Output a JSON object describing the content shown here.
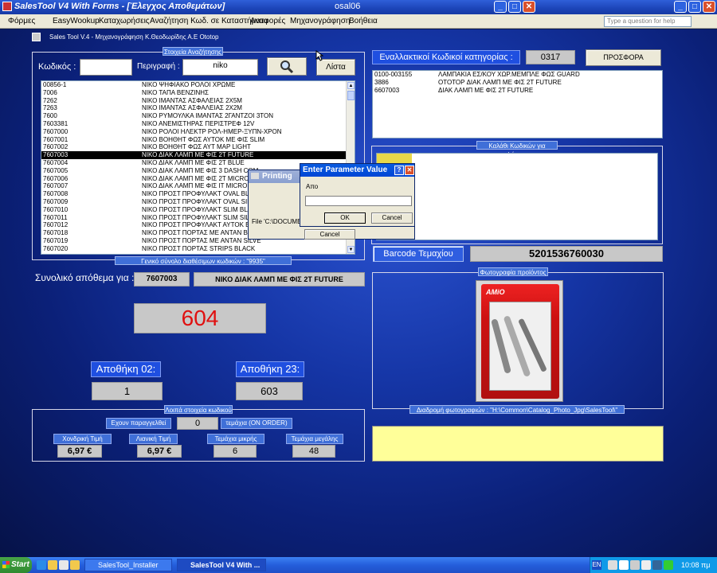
{
  "window": {
    "title": "SalesTool V4 With Forms - [Έλεγχος Αποθεμάτων]",
    "center_title": "osal06",
    "min": "_",
    "max": "□",
    "close": "✕"
  },
  "menu": {
    "items": [
      "Φόρμες",
      "EasyWookup",
      "Καταχωρήσεις",
      "Αναζήτηση Κωδ. σε Καταστήματα",
      "Αναφορές",
      "Μηχανογράφηση",
      "Βοήθεια"
    ],
    "help_placeholder": "Type a question for help"
  },
  "header": {
    "app_caption": "Sales Tool V.4 - Μηχανογράφηση Κ.Θεοδωρίδης Α.Ε  Ototop"
  },
  "search": {
    "caption": "Στοιχεία Αναζήτησης",
    "code_label": "Κωδικός :",
    "code_value": "",
    "desc_label": "Περιγραφή :",
    "desc_value": "niko",
    "list_button": "Λίστα",
    "search_icon": "magnifier-icon"
  },
  "results": {
    "rows": [
      {
        "code": "00856-1",
        "desc": "ΝΙΚΟ ΨΗΦΙΑΚΟ ΡΟΛΟΙ ΧΡΩΜΕ"
      },
      {
        "code": "7006",
        "desc": "ΝΙΚΟ ΤΑΠΑ ΒΕΝΖΙΝΗΣ"
      },
      {
        "code": "7262",
        "desc": "ΝΙΚΟ ΙΜΑΝΤΑΣ ΑΣΦΑΛΕΙΑΣ 2Χ5Μ"
      },
      {
        "code": "7263",
        "desc": "ΝΙΚΟ ΙΜΑΝΤΑΣ ΑΣΦΑΛΕΙΑΣ 2Χ2Μ"
      },
      {
        "code": "7600",
        "desc": "ΝΙΚΟ ΡΥΜΟΥΛΚΑ ΙΜΑΝΤΑΣ 2ΓΑΝΤΖΟΙ 3ΤΟΝ"
      },
      {
        "code": "7603381",
        "desc": "ΝΙΚΟ ΑΝΕΜΙΣΤΗΡΑΣ ΠΕΡΙΣΤΡΕΦ 12V"
      },
      {
        "code": "7607000",
        "desc": "ΝΙΚΟ ΡΟΛΟΙ ΗΛΕΚΤΡ ΡΟΛ-ΗΜΕΡ-ΞΥΠΝ-ΧΡΟΝ"
      },
      {
        "code": "7607001",
        "desc": "ΝΙΚΟ ΒΟΗΘΗΤ ΦΩΣ ΑΥΤΟΚ ΜΕ ΦΙΣ SLIM"
      },
      {
        "code": "7607002",
        "desc": "ΝΙΚΟ ΒΟΗΘΗΤ ΦΩΣ ΑΥΤ ΜΑΡ LIGHT"
      },
      {
        "code": "7607003",
        "desc": "ΝΙΚΟ ΔΙΑΚ ΛΑΜΠ ΜΕ ΦΙΣ 2Τ FUTURE"
      },
      {
        "code": "7607004",
        "desc": "ΝΙΚΟ ΔΙΑΚ ΛΑΜΠ ΜΕ ΦΙΣ 2Τ BLUE"
      },
      {
        "code": "7607005",
        "desc": "ΝΙΚΟ ΔΙΑΚ ΛΑΜΠ ΜΕ ΦΙΣ 3 DASH COM"
      },
      {
        "code": "7607006",
        "desc": "ΝΙΚΟ ΔΙΑΚ ΛΑΜΠ ΜΕ ΦΙΣ 2Τ MICRO"
      },
      {
        "code": "7607007",
        "desc": "ΝΙΚΟ ΔΙΑΚ ΛΑΜΠ ΜΕ ΦΙΣ ΙΤ MICRO"
      },
      {
        "code": "7607008",
        "desc": "ΝΙΚΟ ΠΡΟΣΤ ΠΡΟΦΥΛΑΚΤ OVAL BLACK"
      },
      {
        "code": "7607009",
        "desc": "ΝΙΚΟ ΠΡΟΣΤ ΠΡΟΦΥΛΑΚΤ OVAL SILVER"
      },
      {
        "code": "7607010",
        "desc": "ΝΙΚΟ ΠΡΟΣΤ ΠΡΟΦΥΛΑΚΤ SLIM BLACK"
      },
      {
        "code": "7607011",
        "desc": "ΝΙΚΟ ΠΡΟΣΤ ΠΡΟΦΥΛΑΚΤ SLIM SILVER"
      },
      {
        "code": "7607012",
        "desc": "ΝΙΚΟ ΠΡΟΣΤ ΠΡΟΦΥΛΑΚΤ ΑΥΤΟΚ ΒΛΑΣ"
      },
      {
        "code": "7607018",
        "desc": "ΝΙΚΟ ΠΡΟΣΤ ΠΟΡΤΑΣ ΜΕ ΑΝΤΑΝ BLAC"
      },
      {
        "code": "7607019",
        "desc": "ΝΙΚΟ ΠΡΟΣΤ ΠΟΡΤΑΣ ΜΕ ΑΝΤΑΝ SILVE"
      },
      {
        "code": "7607020",
        "desc": "ΝΙΚΟ ΠΡΟΣΤ ΠΟΡΤΑΣ STRIPS BLACK"
      }
    ],
    "selected_index": 9,
    "total_label": "Γενικό σύνολο διαθέσιμων κωδικών : \"9935\""
  },
  "alt_codes": {
    "label": "Εναλλακτικοί Κωδικοί κατηγορίας :",
    "category": "0317",
    "offer_button": "ΠΡΟΣΦΟΡΑ",
    "rows": [
      {
        "code": "0100-003155",
        "desc": "ΛΑΜΠΑΚΙΑ ΕΣ/ΚΟΥ ΧΩΡ.ΜΕΜΠΛΕ ΦΩΣ GUARD"
      },
      {
        "code": "3886",
        "desc": "OTOTOP ΔΙΑΚ ΛΑΜΠ ΜΕ ΦΙΣ 2Τ FUTURE"
      },
      {
        "code": "6607003",
        "desc": "ΔΙΑΚ ΛΑΜΠ ΜΕ ΦΙΣ 2Τ FUTURE"
      }
    ]
  },
  "basket": {
    "caption": "Καλάθι Κωδικών για Φόρμες"
  },
  "barcode": {
    "button": "Barcode Τεμαχίου",
    "value": "5201536760030"
  },
  "stock": {
    "label": "Συνολικό απόθεμα για :",
    "code": "7607003",
    "desc": "ΝΙΚΟ ΔΙΑΚ ΛΑΜΠ ΜΕ ΦΙΣ 2Τ FUTURE",
    "total": "604",
    "wh1_label": "Αποθήκη 02:",
    "wh1_value": "1",
    "wh2_label": "Αποθήκη 23:",
    "wh2_value": "603"
  },
  "photo": {
    "caption": "Φωτογραφία προϊόντος",
    "brand": "AMiO",
    "path_label": "Διαδρομή φωτογραφιών : \"H:\\Common\\Catalog_Photo_Jpg\\SalesTool\\\""
  },
  "other": {
    "caption": "Λοιπά στοιχεία κωδικού",
    "ordered_label": "Εχουν παραγγελθεί",
    "ordered_value": "0",
    "ordered_suffix": "τεμάχια (ON ORDER)",
    "wholesale_label": "Χονδρική Τιμή",
    "wholesale_value": "6,97 €",
    "retail_label": "Λιανική Τιμή",
    "retail_value": "6,97 €",
    "small_label": "Τεμάχια μικρής",
    "small_value": "6",
    "large_label": "Τεμάχια μεγάλης",
    "large_value": "48"
  },
  "printing_dialog": {
    "title": "Printing",
    "file_text": "File 'C:\\DOCUME~",
    "cancel": "Cancel"
  },
  "param_dialog": {
    "title": "Enter Parameter Value",
    "prompt": "Απο",
    "value": "",
    "ok": "OK",
    "cancel": "Cancel",
    "help": "?",
    "close": "✕"
  },
  "taskbar": {
    "start": "Start",
    "items": [
      "SalesTool_Installer",
      "SalesTool V4 With ..."
    ],
    "lang": "EN",
    "clock": "10:08 πμ"
  },
  "colors": {
    "accent": "#3f6fd8",
    "stock_red": "#e01010",
    "note_yellow": "#ffff99"
  }
}
